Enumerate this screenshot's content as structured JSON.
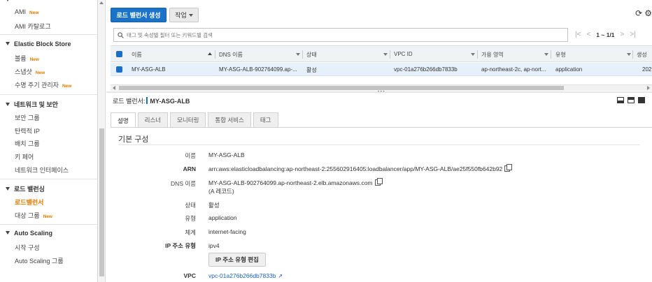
{
  "sidebar": {
    "items_top": [
      {
        "label": "AMI",
        "new": "New"
      },
      {
        "label": "AMI 카탈로그",
        "new": ""
      }
    ],
    "sections": [
      {
        "title": "Elastic Block Store",
        "items": [
          {
            "label": "볼륨",
            "new": "New"
          },
          {
            "label": "스냅샷",
            "new": "New"
          },
          {
            "label": "수명 주기 관리자",
            "new": "New"
          }
        ]
      },
      {
        "title": "네트워크 및 보안",
        "items": [
          {
            "label": "보안 그룹",
            "new": ""
          },
          {
            "label": "탄력적 IP",
            "new": ""
          },
          {
            "label": "배치 그룹",
            "new": ""
          },
          {
            "label": "키 페어",
            "new": ""
          },
          {
            "label": "네트워크 인터페이스",
            "new": ""
          }
        ]
      },
      {
        "title": "로드 밸런싱",
        "items": [
          {
            "label": "로드밸런서",
            "new": ""
          },
          {
            "label": "대상 그룹",
            "new": "New"
          }
        ]
      },
      {
        "title": "Auto Scaling",
        "items": [
          {
            "label": "시작 구성",
            "new": ""
          },
          {
            "label": "Auto Scaling 그룹",
            "new": ""
          }
        ]
      }
    ]
  },
  "toolbar": {
    "create_label": "로드 밸런서 생성",
    "actions_label": "작업",
    "refresh_icon": "refresh-icon",
    "settings_icon": "gear-icon"
  },
  "search": {
    "placeholder": "태그 및 속성별 필터 또는 키워드별 검색"
  },
  "pager": {
    "first": "|<",
    "prev": "<",
    "count": "1 ~ 1/1",
    "next": ">",
    "last": ">|"
  },
  "table": {
    "headers": [
      "이름",
      "DNS 이름",
      "상태",
      "VPC ID",
      "가용 영역",
      "유형",
      "생성"
    ],
    "row": {
      "name": "MY-ASG-ALB",
      "dns": "MY-ASG-ALB-902764099.ap-...",
      "status": "활성",
      "vpc": "vpc-01a276b266db7833b",
      "az": "ap-northeast-2c, ap-nort...",
      "type": "application",
      "created": "202"
    }
  },
  "detail": {
    "prefix": "로드 밸런서:",
    "name": "MY-ASG-ALB",
    "tabs": [
      "설명",
      "리스너",
      "모니터링",
      "통합 서비스",
      "태그"
    ],
    "section_title": "기본 구성",
    "fields": {
      "name_label": "이름",
      "name_value": "MY-ASG-ALB",
      "arn_label": "ARN",
      "arn_value": "arn:aws:elasticloadbalancing:ap-northeast-2:255602916405:loadbalancer/app/MY-ASG-ALB/ae25f550fb642b92",
      "dns_label": "DNS 이름",
      "dns_value": "MY-ASG-ALB-902764099.ap-northeast-2.elb.amazonaws.com",
      "dns_record": "(A 레코드)",
      "state_label": "상태",
      "state_value": "활성",
      "type_label": "유형",
      "type_value": "application",
      "scheme_label": "체계",
      "scheme_value": "internet-facing",
      "ip_label": "IP 주소 유형",
      "ip_value": "ipv4",
      "ip_edit_button": "IP 주소 유형 편집",
      "vpc_label": "VPC",
      "vpc_value": "vpc-01a276b266db7833b"
    }
  },
  "colors": {
    "primary": "#1a73c8",
    "accent_orange": "#e07b00",
    "selected_row": "#e5f0fb",
    "link": "#1a62b8"
  }
}
